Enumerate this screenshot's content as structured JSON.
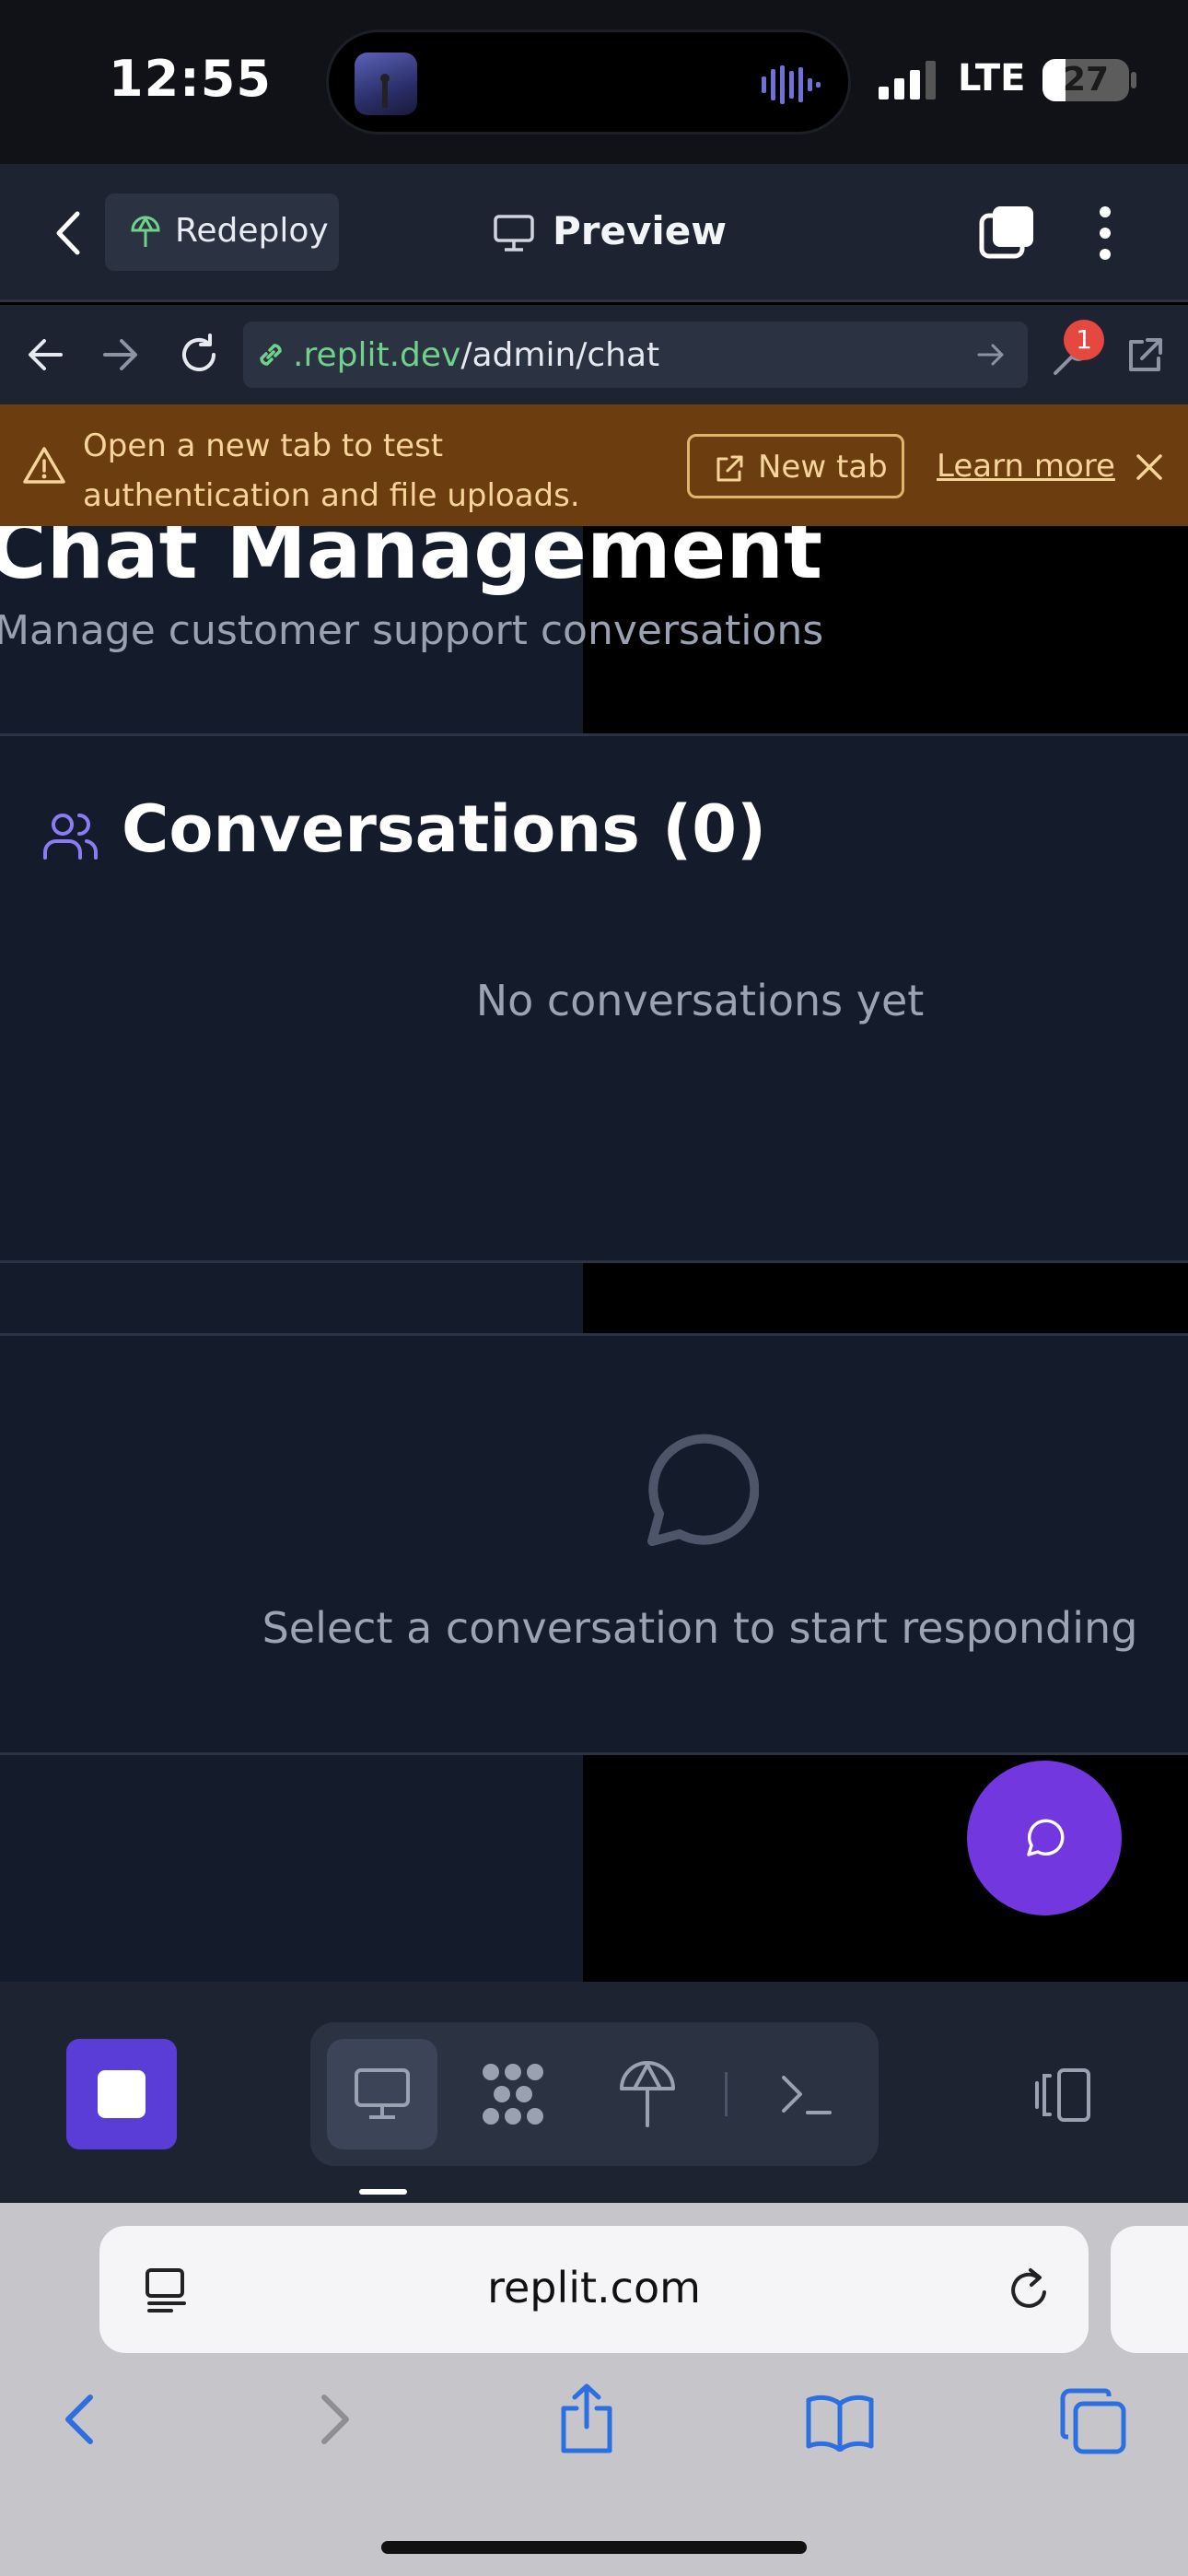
{
  "status_bar": {
    "time": "12:55",
    "network": "LTE",
    "battery": "27",
    "battery_level_percent": 27
  },
  "app_header": {
    "back_icon": "chevron-left-icon",
    "redeploy_label": "Redeploy",
    "preview_label": "Preview",
    "tabs_icon": "stacked-squares-icon",
    "menu_icon": "more-vertical-icon"
  },
  "url_bar": {
    "domain": ".replit.dev",
    "path": "/admin/chat",
    "notification_count": "1"
  },
  "warning": {
    "message": "Open a new tab to test authentication and file uploads.",
    "new_tab_label": "New tab",
    "learn_more_label": "Learn more"
  },
  "page": {
    "title": "Chat Management",
    "subtitle": "Manage customer support conversations",
    "conversations_title": "Conversations (0)",
    "empty_state": "No conversations yet",
    "select_prompt": "Select a conversation to start responding"
  },
  "colors": {
    "accent": "#7337e0",
    "stop_button": "#5a3dd6",
    "banner": "#6b3d0f",
    "link_green": "#6fd18a"
  },
  "safari": {
    "address": "replit.com"
  }
}
